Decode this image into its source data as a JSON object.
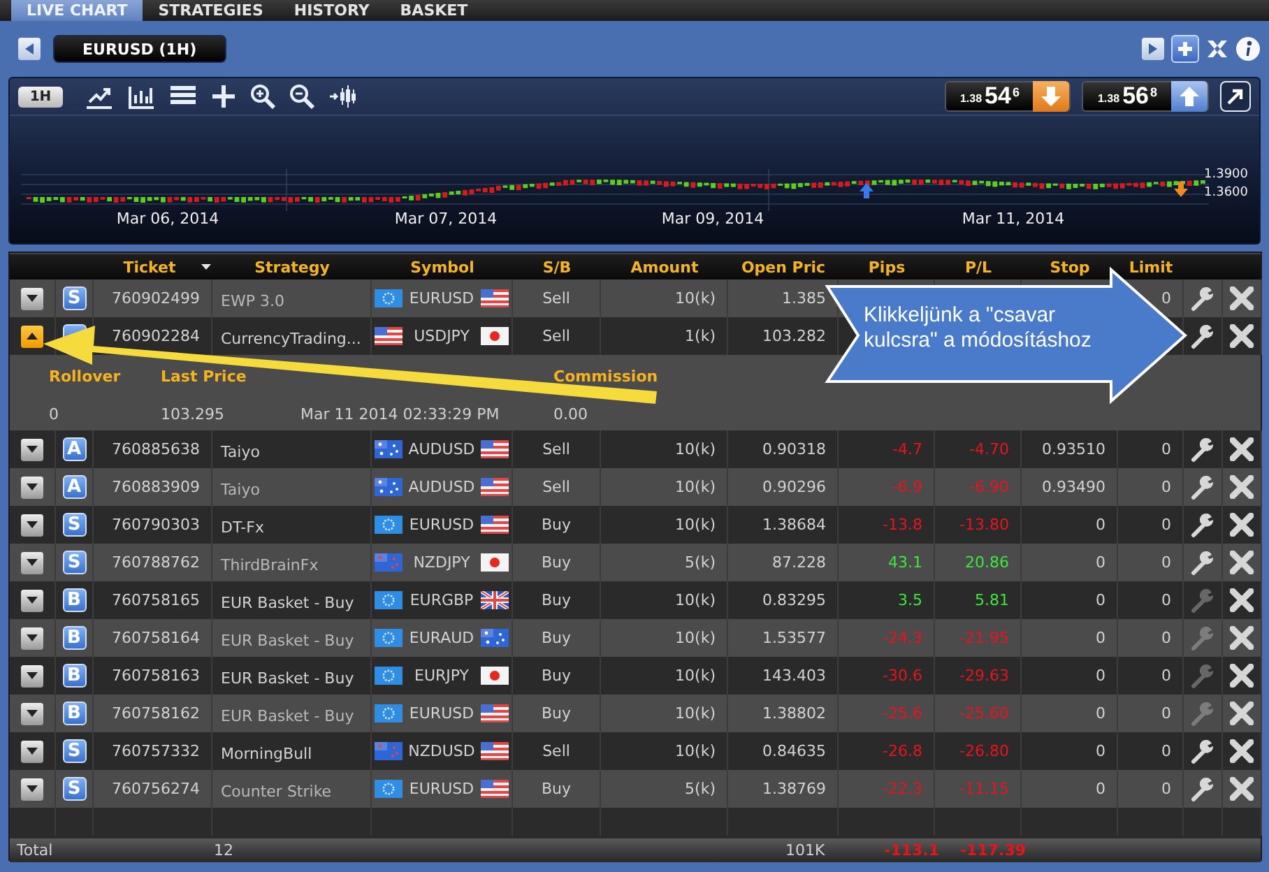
{
  "tabs": [
    {
      "label": "LIVE CHART",
      "selected": true
    },
    {
      "label": "STRATEGIES",
      "selected": false
    },
    {
      "label": "HISTORY",
      "selected": false
    },
    {
      "label": "BASKET",
      "selected": false
    }
  ],
  "chart_header": {
    "symbol": "EURUSD (1H)"
  },
  "chart_toolbar": {
    "timeframe": "1H",
    "prices": [
      {
        "prefix": "1.38",
        "big": "54",
        "pip": "6",
        "kind": "down"
      },
      {
        "prefix": "1.38",
        "big": "56",
        "pip": "8",
        "kind": "up"
      }
    ]
  },
  "chart": {
    "dates": [
      "Mar 06, 2014",
      "Mar 07, 2014",
      "Mar 09, 2014",
      "Mar 11, 2014"
    ],
    "price_labels": [
      "1.3900",
      "1.3600"
    ]
  },
  "table": {
    "columns": [
      "Ticket",
      "Strategy",
      "Symbol",
      "S/B",
      "Amount",
      "Open Pric",
      "Pips",
      "P/L",
      "Stop",
      "Limit"
    ],
    "rows": [
      {
        "expanded": false,
        "badge": "S",
        "ticket": "760902499",
        "strategy": "EWP 3.0",
        "symbol": "EURUSD",
        "flags": [
          {
            "kind": "eu"
          },
          {
            "kind": "us"
          }
        ],
        "side": "Sell",
        "amount": "10(k)",
        "open_price": "1.385",
        "limit": "0",
        "editable": true
      },
      {
        "expanded": true,
        "ticket": "760902284",
        "strategy": "CurrencyTrading...",
        "symbol": "USDJPY",
        "flags": [
          {
            "kind": "us"
          },
          {
            "kind": "jp"
          }
        ],
        "side": "Sell",
        "amount": "1(k)",
        "open_price": "103.282",
        "editable": true,
        "detail": [
          {
            "label": "Rollover",
            "value": "0"
          },
          {
            "label": "Last Price",
            "value": "103.295"
          },
          {
            "value": "Mar 11 2014 02:33:29 PM"
          },
          {
            "label": "Commission",
            "value": "0.00"
          }
        ]
      },
      {
        "expanded": false,
        "badge": "A",
        "ticket": "760885638",
        "strategy": "Taiyo",
        "symbol": "AUDUSD",
        "flags": [
          {
            "kind": "au"
          },
          {
            "kind": "us"
          }
        ],
        "side": "Sell",
        "amount": "10(k)",
        "open_price": "0.90318",
        "pips": "-4.7",
        "pl": "-4.70",
        "profit": false,
        "stop": "0.93510",
        "limit": "0",
        "editable": true
      },
      {
        "expanded": false,
        "badge": "A",
        "ticket": "760883909",
        "strategy": "Taiyo",
        "symbol": "AUDUSD",
        "flags": [
          {
            "kind": "au"
          },
          {
            "kind": "us"
          }
        ],
        "side": "Sell",
        "amount": "10(k)",
        "open_price": "0.90296",
        "pips": "-6.9",
        "pl": "-6.90",
        "profit": false,
        "stop": "0.93490",
        "limit": "0",
        "editable": true
      },
      {
        "expanded": false,
        "badge": "S",
        "ticket": "760790303",
        "strategy": "DT-Fx",
        "symbol": "EURUSD",
        "flags": [
          {
            "kind": "eu"
          },
          {
            "kind": "us"
          }
        ],
        "side": "Buy",
        "amount": "10(k)",
        "open_price": "1.38684",
        "pips": "-13.8",
        "pl": "-13.80",
        "profit": false,
        "stop": "0",
        "limit": "0",
        "editable": true
      },
      {
        "expanded": false,
        "badge": "S",
        "ticket": "760788762",
        "strategy": "ThirdBrainFx",
        "symbol": "NZDJPY",
        "flags": [
          {
            "kind": "nz"
          },
          {
            "kind": "jp"
          }
        ],
        "side": "Buy",
        "amount": "5(k)",
        "open_price": "87.228",
        "pips": "43.1",
        "pl": "20.86",
        "profit": true,
        "stop": "0",
        "limit": "0",
        "editable": true
      },
      {
        "expanded": false,
        "badge": "B",
        "ticket": "760758165",
        "strategy": "EUR Basket - Buy",
        "symbol": "EURGBP",
        "flags": [
          {
            "kind": "eu"
          },
          {
            "kind": "gb"
          }
        ],
        "side": "Buy",
        "amount": "10(k)",
        "open_price": "0.83295",
        "pips": "3.5",
        "pl": "5.81",
        "profit": true,
        "stop": "0",
        "limit": "0",
        "editable": false
      },
      {
        "expanded": false,
        "badge": "B",
        "ticket": "760758164",
        "strategy": "EUR Basket - Buy",
        "symbol": "EURAUD",
        "flags": [
          {
            "kind": "eu"
          },
          {
            "kind": "au"
          }
        ],
        "side": "Buy",
        "amount": "10(k)",
        "open_price": "1.53577",
        "pips": "-24.3",
        "pl": "-21.95",
        "profit": false,
        "stop": "0",
        "limit": "0",
        "editable": false
      },
      {
        "expanded": false,
        "badge": "B",
        "ticket": "760758163",
        "strategy": "EUR Basket - Buy",
        "symbol": "EURJPY",
        "flags": [
          {
            "kind": "eu"
          },
          {
            "kind": "jp"
          }
        ],
        "side": "Buy",
        "amount": "10(k)",
        "open_price": "143.403",
        "pips": "-30.6",
        "pl": "-29.63",
        "profit": false,
        "stop": "0",
        "limit": "0",
        "editable": false
      },
      {
        "expanded": false,
        "badge": "B",
        "ticket": "760758162",
        "strategy": "EUR Basket - Buy",
        "symbol": "EURUSD",
        "flags": [
          {
            "kind": "eu"
          },
          {
            "kind": "us"
          }
        ],
        "side": "Buy",
        "amount": "10(k)",
        "open_price": "1.38802",
        "pips": "-25.6",
        "pl": "-25.60",
        "profit": false,
        "stop": "0",
        "limit": "0",
        "editable": false
      },
      {
        "expanded": false,
        "badge": "S",
        "ticket": "760757332",
        "strategy": "MorningBull",
        "symbol": "NZDUSD",
        "flags": [
          {
            "kind": "nz"
          },
          {
            "kind": "us"
          }
        ],
        "side": "Sell",
        "amount": "10(k)",
        "open_price": "0.84635",
        "pips": "-26.8",
        "pl": "-26.80",
        "profit": false,
        "stop": "0",
        "limit": "0",
        "editable": true
      },
      {
        "expanded": false,
        "badge": "S",
        "ticket": "760756274",
        "strategy": "Counter Strike",
        "symbol": "EURUSD",
        "flags": [
          {
            "kind": "eu"
          },
          {
            "kind": "us"
          }
        ],
        "side": "Buy",
        "amount": "5(k)",
        "open_price": "1.38769",
        "pips": "-22.3",
        "pl": "-11.15",
        "profit": false,
        "stop": "0",
        "limit": "0",
        "editable": true
      }
    ],
    "total": {
      "label": "Total",
      "count": "12",
      "amount": "101K",
      "pips": "-113.1",
      "pl": "-117.39"
    }
  },
  "callout": {
    "text": "Klikkeljünk a \"csavar\nkulcsra\" a módosításhoz"
  }
}
